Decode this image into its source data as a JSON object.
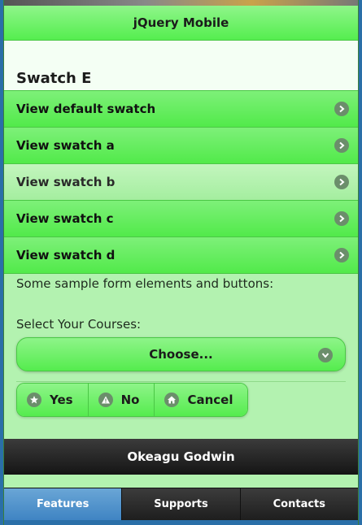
{
  "header": {
    "title": "jQuery Mobile"
  },
  "section": {
    "title": "Swatch E"
  },
  "list": {
    "items": [
      {
        "label": "View default swatch",
        "style": "green"
      },
      {
        "label": "View swatch a",
        "style": "green"
      },
      {
        "label": "View swatch b",
        "style": "light"
      },
      {
        "label": "View swatch c",
        "style": "green"
      },
      {
        "label": "View swatch d",
        "style": "green"
      }
    ]
  },
  "form": {
    "intro": "Some sample form elements and buttons:",
    "select_label": "Select Your Courses:",
    "select_value": "Choose..."
  },
  "buttons": {
    "yes": "Yes",
    "no": "No",
    "cancel": "Cancel"
  },
  "footer": {
    "title": "Okeagu Godwin"
  },
  "navbar": {
    "tabs": [
      {
        "label": "Features",
        "active": true
      },
      {
        "label": "Supports",
        "active": false
      },
      {
        "label": "Contacts",
        "active": false
      }
    ]
  },
  "colors": {
    "accent_green": "#55ee4f",
    "page_bg": "#b3f2b0",
    "footer_dark": "#1b1b1b",
    "nav_active": "#4f92cc"
  }
}
